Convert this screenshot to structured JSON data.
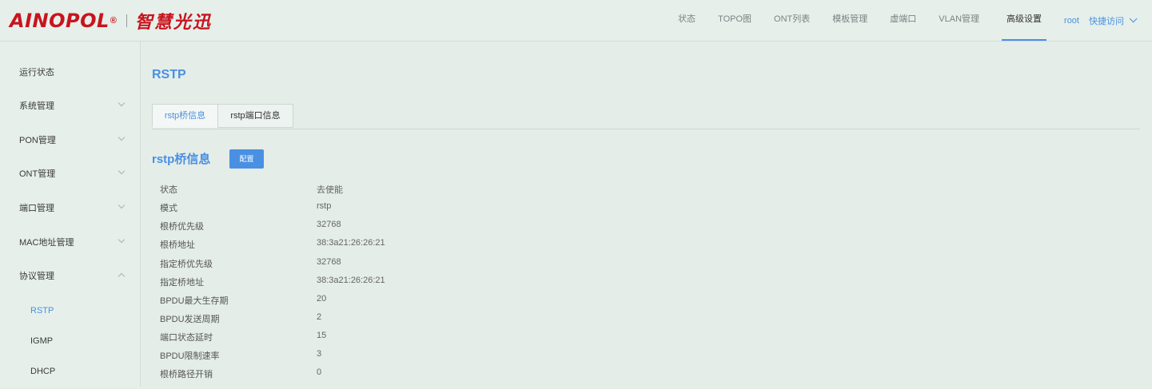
{
  "logo": {
    "brand": "AINOPOL",
    "reg": "®",
    "cn": "智慧光迅"
  },
  "topnav": {
    "items": [
      "状态",
      "TOPO图",
      "ONT列表",
      "模板管理",
      "虚端口",
      "VLAN管理",
      "高级设置"
    ],
    "active": "高级设置",
    "user": "root",
    "quick_access": "快捷访问"
  },
  "sidebar": {
    "items": [
      {
        "label": "运行状态",
        "arrow": ""
      },
      {
        "label": "系统管理",
        "arrow": "down"
      },
      {
        "label": "PON管理",
        "arrow": "down"
      },
      {
        "label": "ONT管理",
        "arrow": "down"
      },
      {
        "label": "端口管理",
        "arrow": "down"
      },
      {
        "label": "MAC地址管理",
        "arrow": "down"
      },
      {
        "label": "协议管理",
        "arrow": "up"
      }
    ],
    "subitems": [
      {
        "label": "RSTP",
        "active": true
      },
      {
        "label": "IGMP",
        "active": false
      },
      {
        "label": "DHCP",
        "active": false
      }
    ]
  },
  "main": {
    "title": "RSTP",
    "tabs": [
      {
        "label": "rstp桥信息",
        "active": true
      },
      {
        "label": "rstp端口信息",
        "active": false
      }
    ],
    "section_title": "rstp桥信息",
    "config_button": "配置",
    "rows": [
      {
        "key": "状态",
        "value": "去使能"
      },
      {
        "key": "模式",
        "value": "rstp"
      },
      {
        "key": "根桥优先级",
        "value": "32768"
      },
      {
        "key": "根桥地址",
        "value": "38:3a21:26:26:21"
      },
      {
        "key": "指定桥优先级",
        "value": "32768"
      },
      {
        "key": "指定桥地址",
        "value": "38:3a21:26:26:21"
      },
      {
        "key": "BPDU最大生存期",
        "value": "20"
      },
      {
        "key": "BPDU发送周期",
        "value": "2"
      },
      {
        "key": "端口状态延时",
        "value": "15"
      },
      {
        "key": "BPDU限制速率",
        "value": "3"
      },
      {
        "key": "根桥路径开销",
        "value": "0"
      }
    ]
  },
  "colors": {
    "accent": "#4a90e2",
    "brand": "#c8141e",
    "background": "#e4ede8"
  }
}
